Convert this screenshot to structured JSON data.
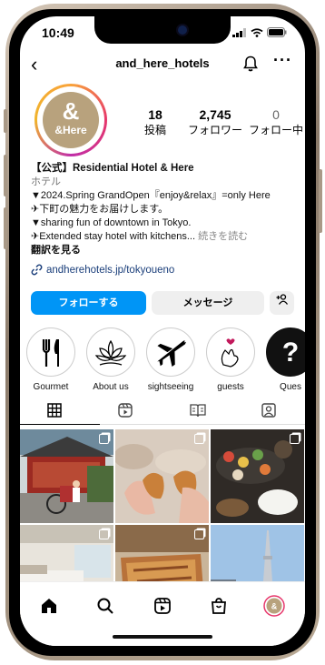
{
  "status": {
    "time": "10:49"
  },
  "header": {
    "username": "and_here_hotels"
  },
  "profile": {
    "avatar_symbol": "&",
    "avatar_text": "&Here",
    "stats": [
      {
        "value": "18",
        "label": "投稿"
      },
      {
        "value": "2,745",
        "label": "フォロワー"
      },
      {
        "value": "0",
        "label": "フォロー中"
      }
    ],
    "name": "【公式】Residential Hotel & Here",
    "category": "ホテル",
    "bio_lines": [
      "▼2024.Spring GrandOpen『enjoy&relax』=only Here",
      "✈下町の魅力をお届けします。",
      "▼sharing fun of downtown in Tokyo.",
      "✈Extended stay hotel with kitchens..."
    ],
    "more": "続きを読む",
    "translate": "翻訳を見る",
    "link": "andherehotels.jp/tokyoueno"
  },
  "actions": {
    "follow": "フォローする",
    "message": "メッセージ",
    "add": "+ዖ"
  },
  "highlights": [
    {
      "label": "Gourmet",
      "icon": "fork-knife-icon"
    },
    {
      "label": "About us",
      "icon": "lotus-icon"
    },
    {
      "label": "sightseeing",
      "icon": "airplane-icon"
    },
    {
      "label": "guests",
      "icon": "heart-hand-icon"
    },
    {
      "label": "Ques",
      "icon": "question-icon"
    }
  ],
  "colors": {
    "accent": "#0095f6",
    "avatar_brand": "#b8a27d"
  }
}
